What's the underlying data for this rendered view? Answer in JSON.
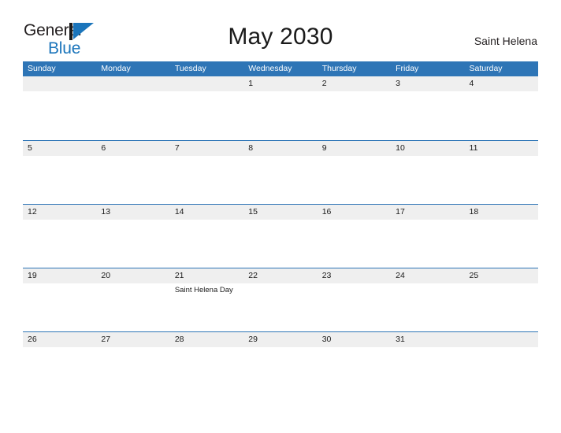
{
  "brand": {
    "name_part1": "General",
    "name_part2": "Blue",
    "flag_icon": "blue-flag-triangle-icon",
    "color_dark": "#231f20",
    "color_blue": "#1b75bb"
  },
  "header": {
    "title": "May 2030",
    "region": "Saint Helena"
  },
  "calendar": {
    "accent_color": "#2e75b6",
    "band_color": "#efefef",
    "weekdays": [
      "Sunday",
      "Monday",
      "Tuesday",
      "Wednesday",
      "Thursday",
      "Friday",
      "Saturday"
    ],
    "weeks": [
      [
        {
          "date": "",
          "events": []
        },
        {
          "date": "",
          "events": []
        },
        {
          "date": "",
          "events": []
        },
        {
          "date": "1",
          "events": []
        },
        {
          "date": "2",
          "events": []
        },
        {
          "date": "3",
          "events": []
        },
        {
          "date": "4",
          "events": []
        }
      ],
      [
        {
          "date": "5",
          "events": []
        },
        {
          "date": "6",
          "events": []
        },
        {
          "date": "7",
          "events": []
        },
        {
          "date": "8",
          "events": []
        },
        {
          "date": "9",
          "events": []
        },
        {
          "date": "10",
          "events": []
        },
        {
          "date": "11",
          "events": []
        }
      ],
      [
        {
          "date": "12",
          "events": []
        },
        {
          "date": "13",
          "events": []
        },
        {
          "date": "14",
          "events": []
        },
        {
          "date": "15",
          "events": []
        },
        {
          "date": "16",
          "events": []
        },
        {
          "date": "17",
          "events": []
        },
        {
          "date": "18",
          "events": []
        }
      ],
      [
        {
          "date": "19",
          "events": []
        },
        {
          "date": "20",
          "events": []
        },
        {
          "date": "21",
          "events": [
            "Saint Helena Day"
          ]
        },
        {
          "date": "22",
          "events": []
        },
        {
          "date": "23",
          "events": []
        },
        {
          "date": "24",
          "events": []
        },
        {
          "date": "25",
          "events": []
        }
      ],
      [
        {
          "date": "26",
          "events": []
        },
        {
          "date": "27",
          "events": []
        },
        {
          "date": "28",
          "events": []
        },
        {
          "date": "29",
          "events": []
        },
        {
          "date": "30",
          "events": []
        },
        {
          "date": "31",
          "events": []
        },
        {
          "date": "",
          "events": []
        }
      ]
    ]
  }
}
